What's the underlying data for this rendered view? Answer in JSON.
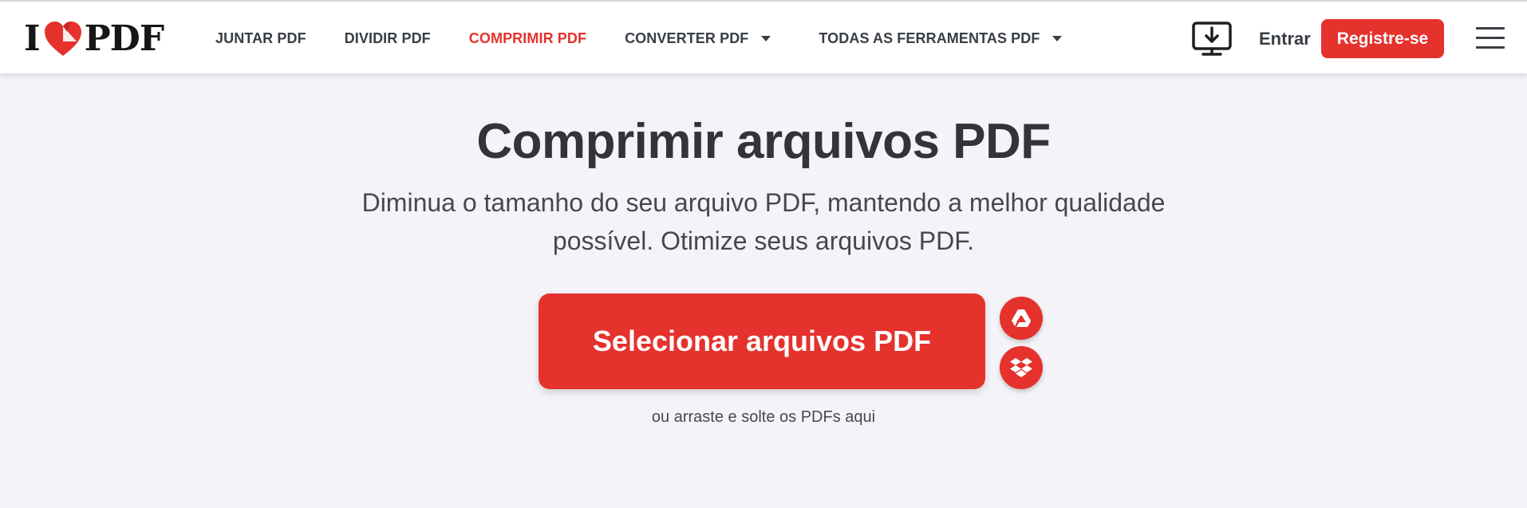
{
  "header": {
    "logo_left": "I",
    "logo_right": "PDF",
    "nav": [
      {
        "label": "JUNTAR PDF"
      },
      {
        "label": "DIVIDIR PDF"
      },
      {
        "label": "COMPRIMIR PDF",
        "active": true
      },
      {
        "label": "CONVERTER PDF",
        "dropdown": true
      },
      {
        "label": "TODAS AS FERRAMENTAS PDF",
        "dropdown": true
      }
    ],
    "login_label": "Entrar",
    "register_label": "Registre-se",
    "icons": [
      "desktop-download-icon",
      "hamburger-menu-icon"
    ]
  },
  "main": {
    "title": "Comprimir arquivos PDF",
    "subtitle_line1": "Diminua o tamanho do seu arquivo PDF, mantendo a melhor qualidade",
    "subtitle_line2": "possível. Otimize seus arquivos PDF.",
    "select_label": "Selecionar arquivos PDF",
    "drop_hint": "ou arraste e solte os PDFs aqui",
    "cloud_icons": [
      "google-drive-icon",
      "dropbox-icon"
    ]
  },
  "colors": {
    "accent": "#e5322d",
    "background": "#f4f4f8",
    "text": "#33333b"
  }
}
